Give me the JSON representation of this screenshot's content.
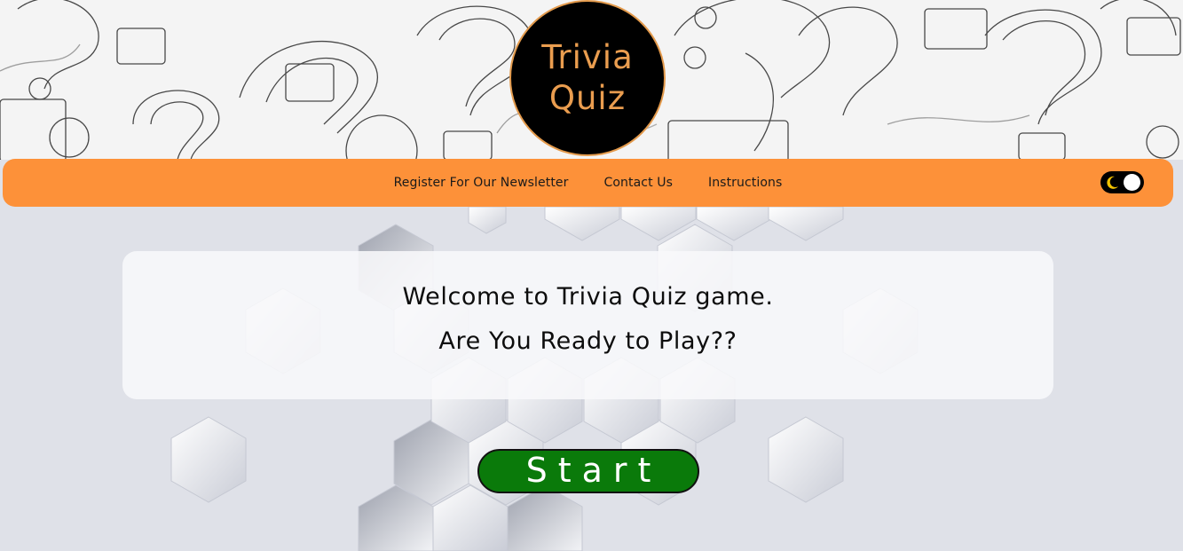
{
  "logo": {
    "line1": "Trivia",
    "line2": "Quiz"
  },
  "nav": {
    "links": [
      {
        "label": "Register For Our Newsletter"
      },
      {
        "label": "Contact Us"
      },
      {
        "label": "Instructions"
      }
    ],
    "theme_toggle": {
      "icon": "moon-icon",
      "state": "light"
    }
  },
  "welcome": {
    "line1": "Welcome to Trivia Quiz game.",
    "line2": "Are You Ready to Play??"
  },
  "start_button": {
    "label": "Start"
  },
  "colors": {
    "nav_background": "#fd9139",
    "logo_text": "#ea9d4f",
    "logo_background": "#000000",
    "start_button": "#0a7a0a",
    "page_background": "#dfe1e8"
  }
}
